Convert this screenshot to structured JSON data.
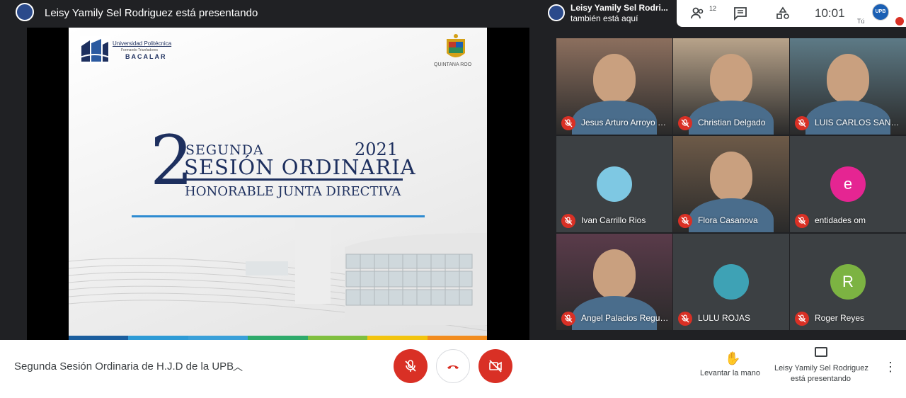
{
  "header": {
    "presenter_title": "Leisy Yamily Sel Rodriguez está presentando",
    "also_here_name": "Leisy Yamily Sel Rodri...",
    "also_here_text": "también está aquí",
    "people_count": "12",
    "clock": "10:01",
    "self_label": "Tú",
    "self_avatar_text": "UPB"
  },
  "slide": {
    "university_line1": "Universidad Politécnica",
    "university_line2": "Formando Triunfadores",
    "university_line3": "BACALAR",
    "state_text": "QUINTANA ROO",
    "big_number": "2",
    "word_segunda": "SEGUNDA",
    "year": "2021",
    "word_sesion": "SESIÓN ORDINARIA",
    "word_honorable": "HONORABLE JUNTA DIRECTIVA",
    "stripe_colors": [
      "#1b5e9e",
      "#2e9bd6",
      "#3aa0d9",
      "#2eaa6b",
      "#7fbf3f",
      "#f2c40f",
      "#f28c1e"
    ]
  },
  "participants": [
    {
      "name": "Jesus Arturo Arroyo F...",
      "type": "video",
      "bg": "#8c6f5e"
    },
    {
      "name": "Christian Delgado",
      "type": "video",
      "bg": "#b8a38a"
    },
    {
      "name": "LUIS CARLOS SANTA...",
      "type": "video",
      "bg": "#5d7a86"
    },
    {
      "name": "Ivan Carrillo Rios",
      "type": "avatar",
      "avatar_text": "",
      "color": "#7ec8e3"
    },
    {
      "name": "Flora Casanova",
      "type": "video",
      "bg": "#6d5a48"
    },
    {
      "name": "entidades om",
      "type": "avatar",
      "avatar_text": "e",
      "color": "#e52592"
    },
    {
      "name": "Angel Palacios Regules",
      "type": "video",
      "bg": "#5a3b4a"
    },
    {
      "name": "LULU ROJAS",
      "type": "avatar",
      "avatar_text": "",
      "color": "#3ea2b5"
    },
    {
      "name": "Roger Reyes",
      "type": "avatar",
      "avatar_text": "R",
      "color": "#7cb342"
    }
  ],
  "footer": {
    "meeting_title": "Segunda Sesión Ordinaria de H.J.D de la UPB",
    "raise_hand_label": "Levantar la mano",
    "presenting_line1": "Leisy Yamily Sel Rodriguez",
    "presenting_line2": "está presentando"
  },
  "colors": {
    "danger": "#d93025",
    "tile_bg": "#3c4043",
    "navy": "#1d2f5e"
  },
  "icons": {
    "people": "people-icon",
    "chat": "chat-icon",
    "activities": "activities-icon",
    "mic_off": "mic-off-icon",
    "end_call": "end-call-icon",
    "camera_off": "camera-off-icon",
    "raise_hand": "raise-hand-icon",
    "present": "present-icon",
    "more": "more-options-icon"
  }
}
